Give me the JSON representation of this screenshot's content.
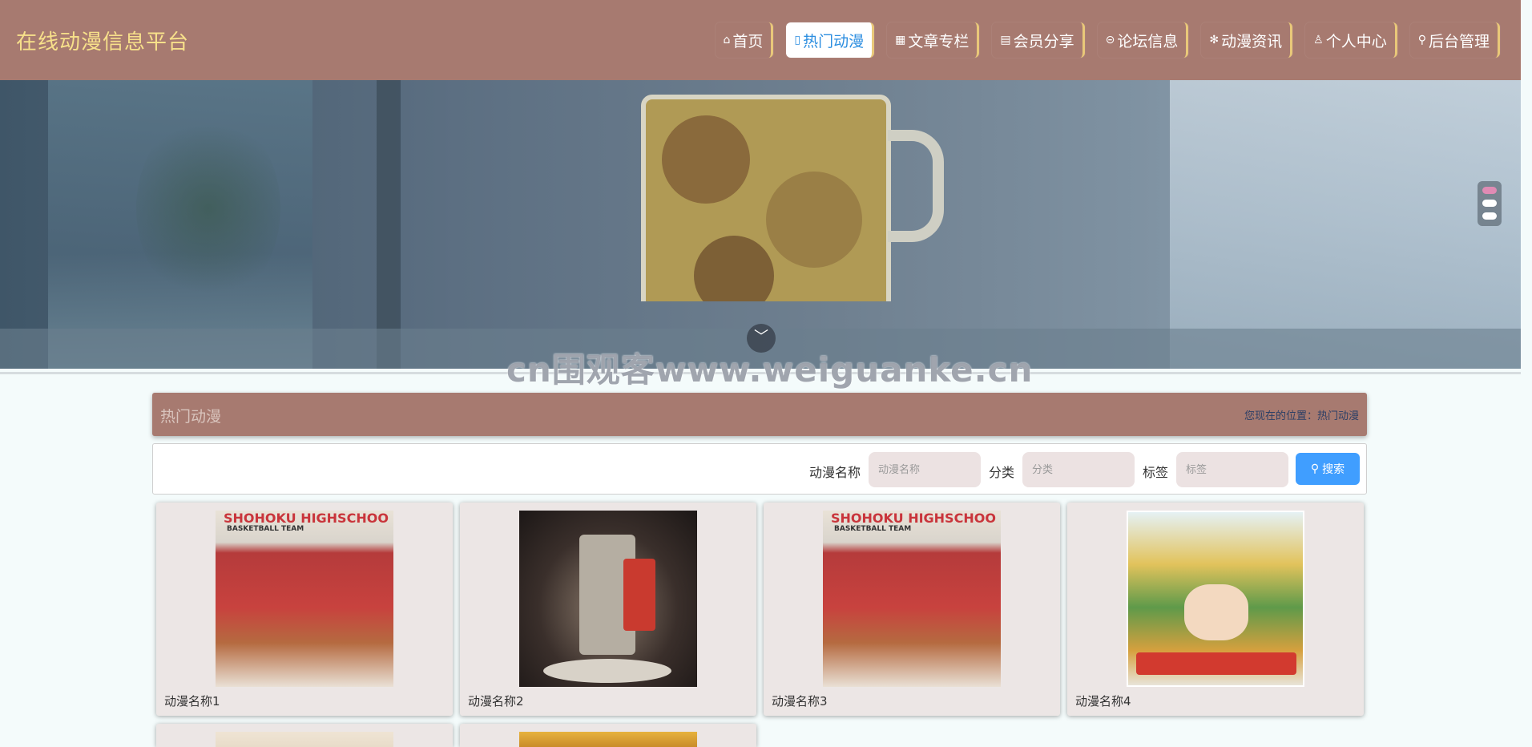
{
  "header": {
    "logo": "在线动漫信息平台",
    "nav": [
      {
        "icon": "⌂",
        "label": "首页",
        "active": false
      },
      {
        "icon": "▯",
        "label": "热门动漫",
        "active": true
      },
      {
        "icon": "▦",
        "label": "文章专栏",
        "active": false
      },
      {
        "icon": "▤",
        "label": "会员分享",
        "active": false
      },
      {
        "icon": "⊝",
        "label": "论坛信息",
        "active": false
      },
      {
        "icon": "✻",
        "label": "动漫资讯",
        "active": false
      },
      {
        "icon": "♙",
        "label": "个人中心",
        "active": false
      },
      {
        "icon": "⚲",
        "label": "后台管理",
        "active": false
      }
    ]
  },
  "banner": {
    "scroll_icon": "﹀",
    "watermark": "cn围观客www.weiguanke.cn"
  },
  "section": {
    "title": "热门动漫",
    "location": "您现在的位置：热门动漫"
  },
  "search": {
    "name_label": "动漫名称",
    "name_placeholder": "动漫名称",
    "category_label": "分类",
    "category_placeholder": "分类",
    "tag_label": "标签",
    "tag_placeholder": "标签",
    "button_label": "搜索",
    "button_color": "#409eff"
  },
  "cards": [
    {
      "name": "动漫名称1"
    },
    {
      "name": "动漫名称2"
    },
    {
      "name": "动漫名称3"
    },
    {
      "name": "动漫名称4"
    }
  ],
  "colors": {
    "header_bg": "#a77a70",
    "logo": "#f7e08a",
    "active_nav_text": "#2c8ee0"
  }
}
